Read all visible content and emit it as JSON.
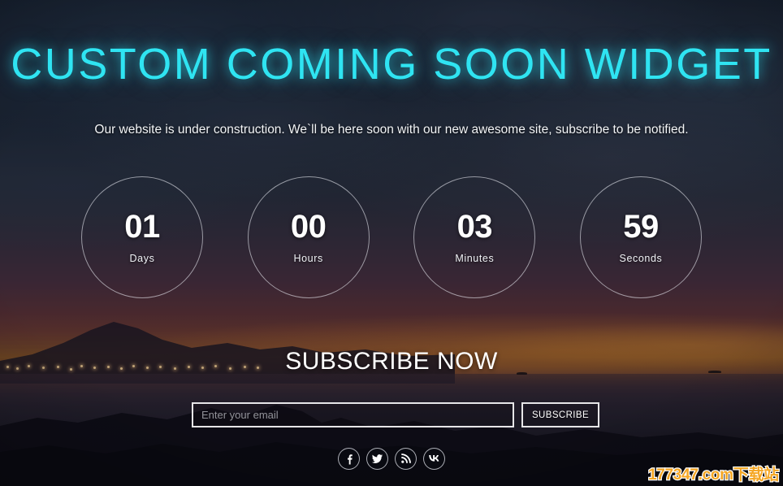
{
  "page": {
    "title": "CUSTOM COMING SOON WIDGET",
    "subtitle": "Our website is under construction. We`ll be here soon with our new awesome site, subscribe to be notified.",
    "accent_color": "#2fe4f2",
    "text_color": "#ffffff"
  },
  "countdown": {
    "units": [
      {
        "value": "01",
        "label": "Days"
      },
      {
        "value": "00",
        "label": "Hours"
      },
      {
        "value": "03",
        "label": "Minutes"
      },
      {
        "value": "59",
        "label": "Seconds"
      }
    ]
  },
  "subscribe": {
    "heading": "SUBSCRIBE NOW",
    "email_placeholder": "Enter your email",
    "email_value": "",
    "button_label": "SUBSCRIBE"
  },
  "socials": [
    {
      "name": "facebook-icon",
      "label": "Facebook"
    },
    {
      "name": "twitter-icon",
      "label": "Twitter"
    },
    {
      "name": "rss-icon",
      "label": "RSS"
    },
    {
      "name": "vk-icon",
      "label": "VK"
    }
  ],
  "watermark": {
    "site": "177347.com",
    "suffix": "下载站",
    "color": "#f5a623"
  }
}
